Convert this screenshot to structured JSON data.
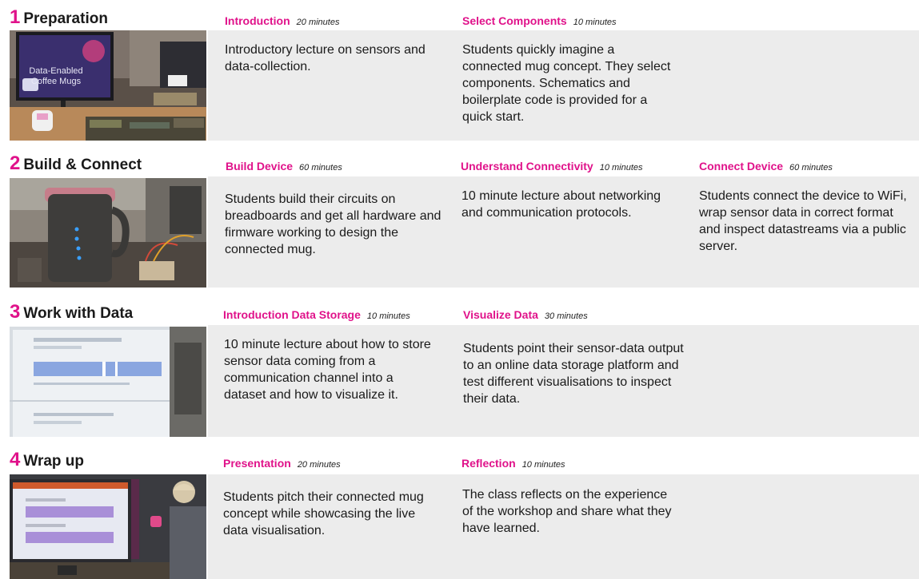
{
  "phases": [
    {
      "number": "1",
      "title": "Preparation",
      "image_overlay": {
        "line1": "Data-Enabled",
        "line2": "Coffee Mugs"
      },
      "activities": [
        {
          "title": "Introduction",
          "duration": "20 minutes",
          "description": "Introductory lecture on sensors and data-collection."
        },
        {
          "title": "Select Components",
          "duration": "10 minutes",
          "description": "Students quickly imagine a connected mug concept. They select components. Schematics and boilerplate code is provided for a quick start."
        }
      ]
    },
    {
      "number": "2",
      "title": "Build & Connect",
      "activities": [
        {
          "title": "Build Device",
          "duration": "60 minutes",
          "description": "Students build their circuits on breadboards and get all hardware and firmware working to design the connected mug."
        },
        {
          "title": "Understand Connectivity",
          "duration": "10 minutes",
          "description": "10 minute lecture about networking and communication protocols."
        },
        {
          "title": "Connect Device",
          "duration": "60 minutes",
          "description": "Students connect the device to WiFi, wrap sensor data in correct format and inspect datastreams via a public server."
        }
      ]
    },
    {
      "number": "3",
      "title": "Work with Data",
      "activities": [
        {
          "title": "Introduction Data Storage",
          "duration": "10 minutes",
          "description": "10 minute lecture about how to store sensor data coming from a communication channel into a dataset and how to visualize it."
        },
        {
          "title": "Visualize Data",
          "duration": "30 minutes",
          "description": "Students point their sensor-data output to an online data storage platform and test different visualisations to inspect their data."
        }
      ]
    },
    {
      "number": "4",
      "title": "Wrap up",
      "activities": [
        {
          "title": "Presentation",
          "duration": "20 minutes",
          "description": "Students pitch their connected mug concept while showcasing the live data visualisation."
        },
        {
          "title": "Reflection",
          "duration": "10 minutes",
          "description": "The class reflects on the experience of the workshop and share what they have learned."
        }
      ]
    }
  ],
  "colors": {
    "accent": "#e0128a",
    "band": "#ececec",
    "text": "#1a1a1a"
  }
}
